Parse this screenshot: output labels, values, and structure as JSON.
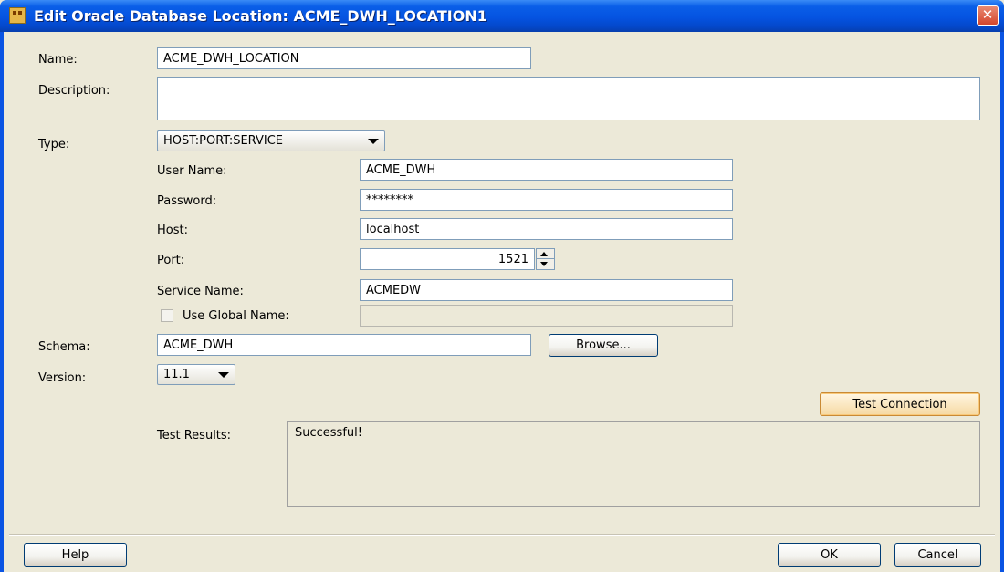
{
  "window": {
    "title": "Edit Oracle Database Location: ACME_DWH_LOCATION1",
    "close_glyph": "✕"
  },
  "form": {
    "name_label": "Name:",
    "name_value": "ACME_DWH_LOCATION",
    "description_label": "Description:",
    "description_value": "",
    "type_label": "Type:",
    "type_value": "HOST:PORT:SERVICE",
    "user_name_label": "User Name:",
    "user_name_value": "ACME_DWH",
    "password_label": "Password:",
    "password_value": "********",
    "host_label": "Host:",
    "host_value": "localhost",
    "port_label": "Port:",
    "port_value": "1521",
    "service_name_label": "Service Name:",
    "service_name_value": "ACMEDW",
    "use_global_name_label": "Use Global Name:",
    "global_name_value": "",
    "schema_label": "Schema:",
    "schema_value": "ACME_DWH",
    "browse_label": "Browse...",
    "version_label": "Version:",
    "version_value": "11.1"
  },
  "test": {
    "button_label": "Test Connection",
    "results_label": "Test Results:",
    "results_value": "Successful!"
  },
  "footer": {
    "help_label": "Help",
    "ok_label": "OK",
    "cancel_label": "Cancel"
  },
  "colors": {
    "titlebar": "#0553E1",
    "dialog_bg": "#ECE9D8",
    "close": "#D4462C"
  },
  "icons": {
    "title_icon": "oracle-warehouse-icon",
    "close_icon": "close-icon"
  }
}
